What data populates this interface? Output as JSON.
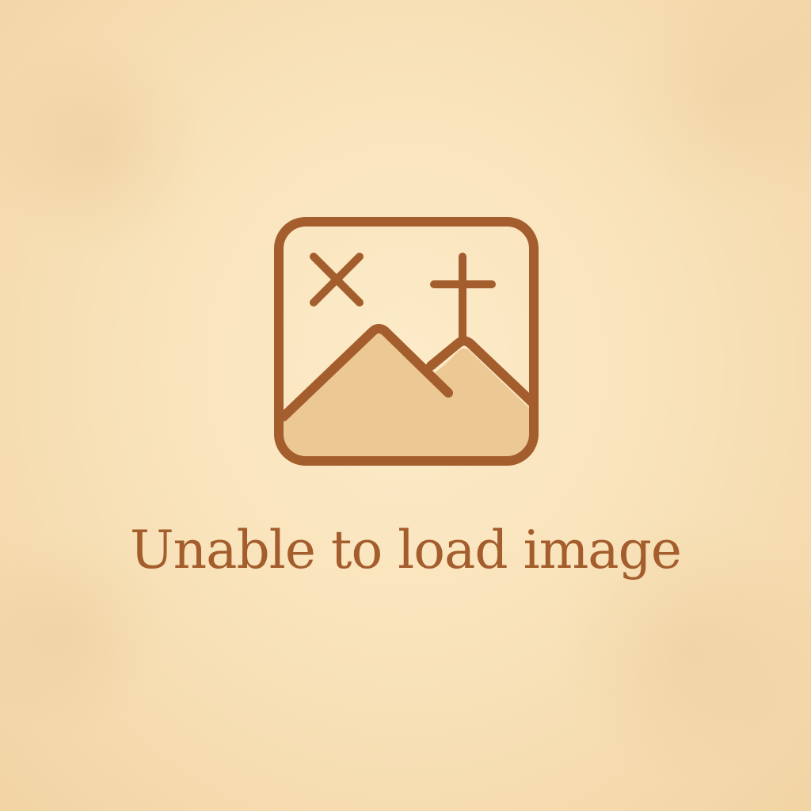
{
  "error": {
    "message": "Unable to load image",
    "icon": "broken-image-icon"
  },
  "colors": {
    "background": "#f9e3bb",
    "accent": "#a45d2c",
    "hill_fill": "#ecc894"
  }
}
